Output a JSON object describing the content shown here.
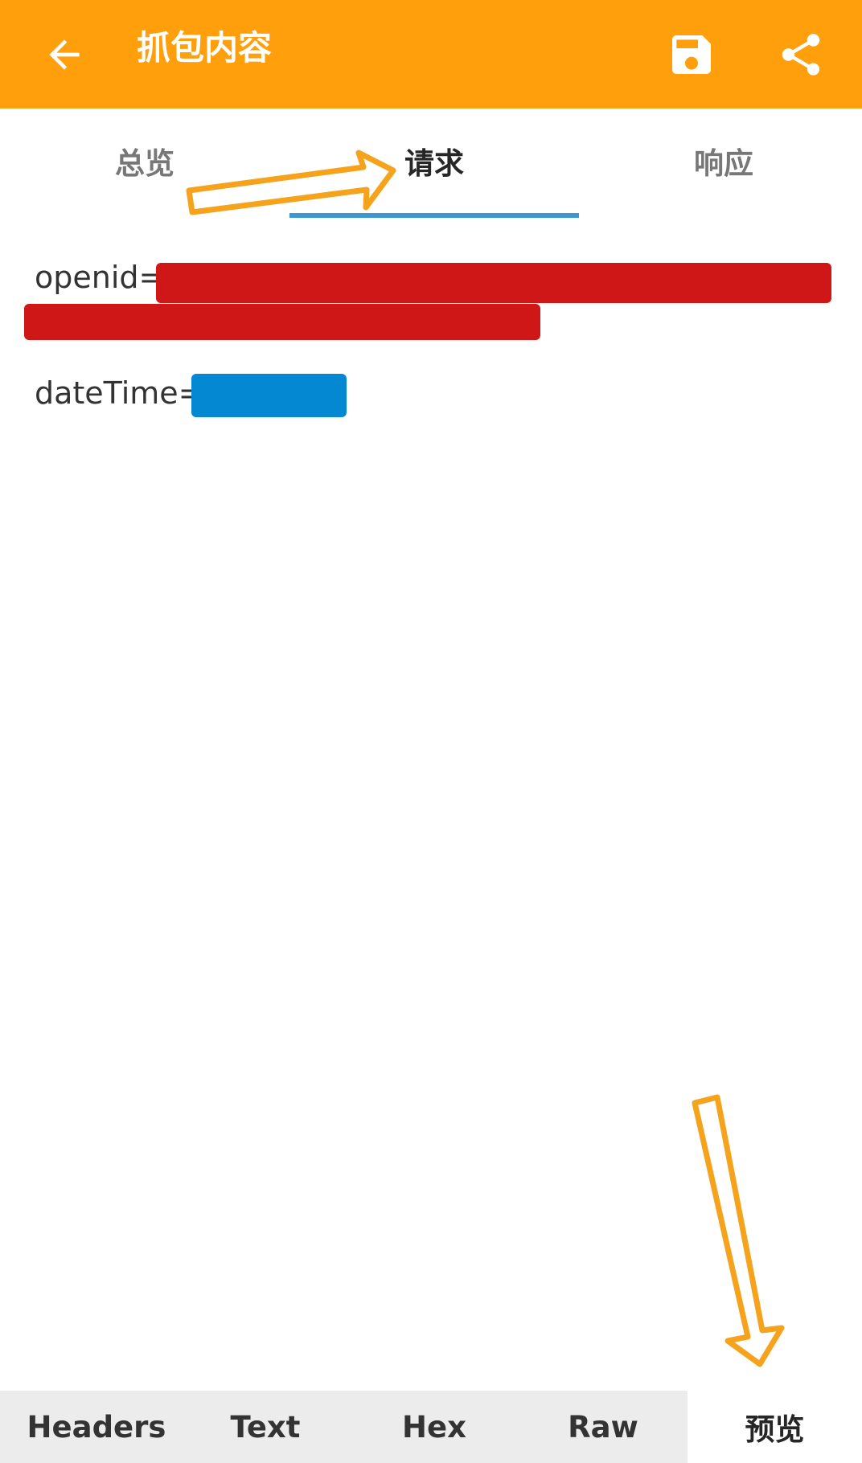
{
  "toolbar": {
    "title": "抓包内容",
    "back_icon": "arrow-back-icon",
    "save_icon": "save-icon",
    "share_icon": "share-icon",
    "background": "#fe9f0b"
  },
  "tabs": [
    {
      "label": "总览",
      "active": false
    },
    {
      "label": "请求",
      "active": true
    },
    {
      "label": "响应",
      "active": false
    }
  ],
  "tab_indicator_color": "#3d97d2",
  "params": {
    "openid_label": "openid=",
    "datetime_label": "dateTime="
  },
  "redaction_colors": {
    "openid": "#d01718",
    "datetime": "#0488d2"
  },
  "annotation_color": "#f5a31c",
  "bottom_tabs": [
    {
      "label": "Headers",
      "active": false
    },
    {
      "label": "Text",
      "active": false
    },
    {
      "label": "Hex",
      "active": false
    },
    {
      "label": "Raw",
      "active": false
    },
    {
      "label": "预览",
      "active": true
    }
  ]
}
